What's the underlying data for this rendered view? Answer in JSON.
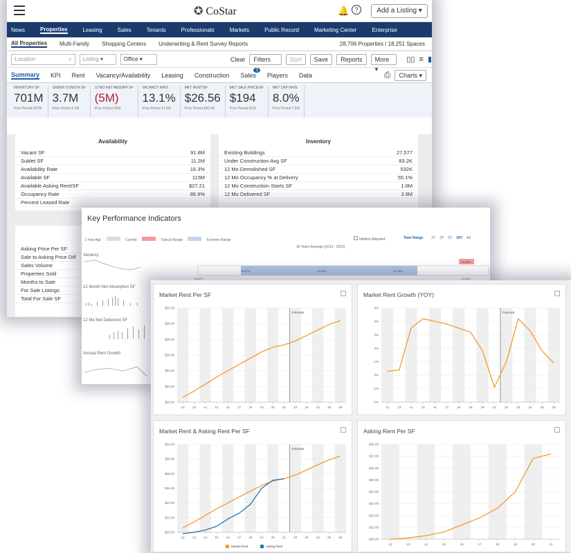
{
  "app": {
    "brand": "CoStar",
    "add_listing": "Add a Listing ▾"
  },
  "nav": [
    "News",
    "Properties",
    "Leasing",
    "Sales",
    "Tenants",
    "Professionals",
    "Markets",
    "Public Record",
    "Marketing Center",
    "Enterprise"
  ],
  "subnav": {
    "items": [
      "All Properties",
      "Multi-Family",
      "Shopping Centers",
      "Underwriting & Rent Survey Reports"
    ],
    "count": "28,706 Properties / 18,251 Spaces"
  },
  "toolbar": {
    "location_placeholder": "Location",
    "listing": "Listing",
    "office": "Office",
    "clear": "Clear",
    "filters": "Filters",
    "filters_count": "1",
    "sort": "Sort",
    "save": "Save",
    "reports": "Reports",
    "more": "More ▾"
  },
  "tabs": [
    "Summary",
    "KPI",
    "Rent",
    "Vacancy/Availability",
    "Leasing",
    "Construction",
    "Sales",
    "Players",
    "Data"
  ],
  "charts_btn": "Charts ▾",
  "kpis": [
    {
      "label": "INVENTORY SF",
      "value": "701M",
      "prior": "Prior Period 697M",
      "neg": false
    },
    {
      "label": "UNDER CONSTR SF",
      "value": "3.7M",
      "prior": "Prior Period 6.1M",
      "neg": false
    },
    {
      "label": "12 MO NET ABSORP SF",
      "value": "(5M)",
      "prior": "Prior Period (5M)",
      "neg": true
    },
    {
      "label": "VACANCY RATE",
      "value": "13.1%",
      "prior": "Prior Period 11.9%",
      "neg": false
    },
    {
      "label": "MKT RENT/SF",
      "value": "$26.56",
      "prior": "Prior Period $26.44",
      "neg": false
    },
    {
      "label": "MKT SALE PRICE/SF",
      "value": "$194",
      "prior": "Prior Period $191",
      "neg": false
    },
    {
      "label": "MKT CAP RATE",
      "value": "8.0%",
      "prior": "Prior Period 7.9%",
      "neg": false
    }
  ],
  "availability": {
    "title": "Availability",
    "rows": [
      [
        "Vacant SF",
        "91.8M"
      ],
      [
        "Sublet SF",
        "11.2M"
      ],
      [
        "Availability Rate",
        "16.3%"
      ],
      [
        "Available SF",
        "115M"
      ],
      [
        "Available Asking Rent/SF",
        "$27.21"
      ],
      [
        "Occupancy Rate",
        "86.9%"
      ],
      [
        "Percent Leased Rate",
        ""
      ]
    ]
  },
  "inventory": {
    "title": "Inventory",
    "rows": [
      [
        "Existing Buildings",
        "27,577"
      ],
      [
        "Under Construction Avg SF",
        "83.2K"
      ],
      [
        "12 Mo Demolished SF",
        "532K"
      ],
      [
        "12 Mo Occupancy % at Delivery",
        "55.1%"
      ],
      [
        "12 Mo Construction Starts SF",
        "1.6M"
      ],
      [
        "12 Mo Delivered SF",
        "3.9M"
      ]
    ]
  },
  "sales_rows": [
    "Asking Price Per SF",
    "Sale to Asking Price Diff",
    "Sales Volume",
    "Properties Sold",
    "Months to Sale",
    "For Sale Listings",
    "Total For Sale SF"
  ],
  "kpi_window": {
    "title": "Key Performance Indicators",
    "legend": [
      "1 Year Ago",
      "Current",
      "Typical Range",
      "Extreme Range"
    ],
    "inflation": "Inflation Adjusted",
    "time_range": "Time Range",
    "ranges": [
      "1Y",
      "3Y",
      "5Y",
      "10Y",
      "All"
    ],
    "avg_label": "10 Years Average (2012 - 2022)",
    "rows": [
      "Vacancy",
      "12 Month Net Absorption SF",
      "12 Mo Net Delivered SF",
      "Annual Rent Growth"
    ],
    "vacancy_values": [
      "10.02%",
      "10.47%",
      "11.43%",
      "12.39%",
      "12.88%",
      "13.08%",
      "13.09%"
    ]
  },
  "charts": [
    {
      "title": "Market Rent Per SF"
    },
    {
      "title": "Market Rent Growth (YOY)"
    },
    {
      "title": "Market Rent & Asking Rent Per SF",
      "legend": [
        "Market Rent",
        "Asking Rent"
      ]
    },
    {
      "title": "Asking Rent Per SF"
    }
  ],
  "forecast_label": "Forecast",
  "chart_data": [
    {
      "type": "line",
      "title": "Market Rent Per SF",
      "x": [
        "12",
        "13",
        "14",
        "15",
        "16",
        "17",
        "18",
        "19",
        "20",
        "21",
        "22",
        "23",
        "24",
        "25",
        "26"
      ],
      "yticks": [
        "$20.00",
        "$22.00",
        "$24.00",
        "$26.00",
        "$28.00",
        "$30.00",
        "$32.00"
      ],
      "ylim": [
        20,
        32
      ],
      "series": [
        {
          "values": [
            20.6,
            21.4,
            22.3,
            23.2,
            24.0,
            24.8,
            25.6,
            26.4,
            27.0,
            27.3,
            27.8,
            28.5,
            29.2,
            29.9,
            30.4
          ]
        }
      ]
    },
    {
      "type": "line",
      "title": "Market Rent Growth (YOY)",
      "x": [
        "12",
        "13",
        "14",
        "15",
        "16",
        "17",
        "18",
        "19",
        "20",
        "21",
        "22",
        "23",
        "24",
        "25",
        "26"
      ],
      "yticks": [
        "-2%",
        "-1%",
        "0%",
        "1%",
        "2%",
        "3%",
        "4%",
        "5%"
      ],
      "ylim": [
        -2,
        5
      ],
      "series": [
        {
          "values": [
            0.3,
            0.4,
            3.5,
            4.2,
            4.0,
            3.8,
            3.5,
            3.2,
            1.8,
            -0.9,
            1.0,
            4.2,
            3.3,
            1.8,
            0.9
          ]
        }
      ]
    },
    {
      "type": "line",
      "title": "Market Rent & Asking Rent Per SF",
      "x": [
        "12",
        "13",
        "14",
        "15",
        "16",
        "17",
        "18",
        "19",
        "20",
        "21",
        "22",
        "23",
        "24",
        "25",
        "26"
      ],
      "yticks": [
        "$20.00",
        "$22.00",
        "$24.00",
        "$26.00",
        "$28.00",
        "$30.00",
        "$32.00"
      ],
      "ylim": [
        20,
        32
      ],
      "series": [
        {
          "name": "Market Rent",
          "values": [
            20.6,
            21.4,
            22.3,
            23.2,
            24.0,
            24.8,
            25.6,
            26.4,
            27.0,
            27.3,
            27.8,
            28.5,
            29.2,
            29.9,
            30.4
          ]
        },
        {
          "name": "Asking Rent",
          "values": [
            19.8,
            20.0,
            20.3,
            20.8,
            21.8,
            22.6,
            23.8,
            26.0,
            27.1,
            27.3
          ]
        }
      ]
    },
    {
      "type": "line",
      "title": "Asking Rent Per SF",
      "x": [
        "12",
        "13",
        "14",
        "15",
        "16",
        "17",
        "18",
        "19",
        "20",
        "21"
      ],
      "yticks": [
        "$20.00",
        "$21.00",
        "$22.00",
        "$23.00",
        "$24.00",
        "$25.00",
        "$26.00",
        "$27.00",
        "$28.00"
      ],
      "ylim": [
        20,
        28
      ],
      "series": [
        {
          "values": [
            20.0,
            20.1,
            20.3,
            20.6,
            21.2,
            21.8,
            22.6,
            24.0,
            26.8,
            27.2
          ]
        }
      ]
    }
  ]
}
